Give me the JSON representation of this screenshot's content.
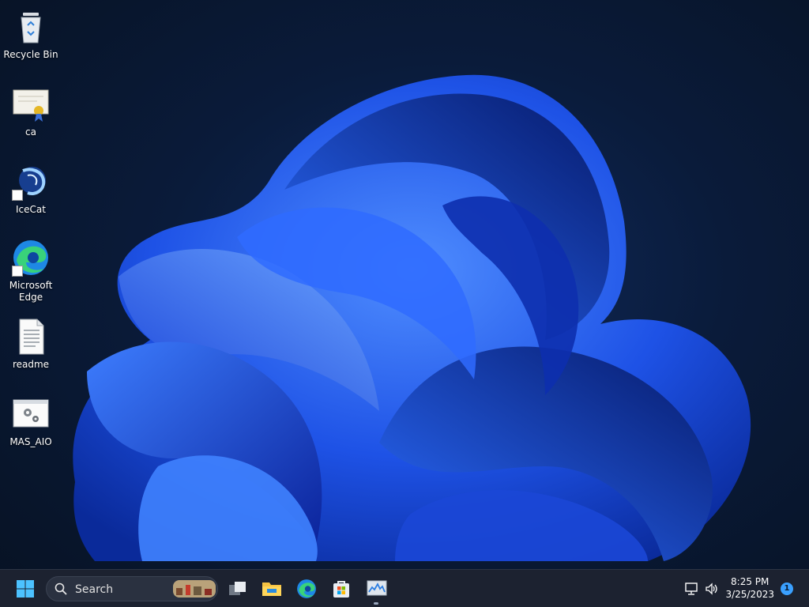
{
  "desktop": {
    "icons": [
      {
        "label": "Recycle Bin"
      },
      {
        "label": "ca"
      },
      {
        "label": "IceCat"
      },
      {
        "label": "Microsoft Edge"
      },
      {
        "label": "readme"
      },
      {
        "label": "MAS_AIO"
      }
    ]
  },
  "taskbar": {
    "search_placeholder": "Search",
    "apps": [
      "task-view",
      "file-explorer",
      "microsoft-edge",
      "microsoft-store",
      "task-manager"
    ],
    "time": "8:25 PM",
    "date": "3/25/2023",
    "notification_count": "1"
  },
  "colors": {
    "wallpaper_blue": "#1e5bff",
    "taskbar": "#1c2230",
    "accent": "#3aa0ff"
  }
}
